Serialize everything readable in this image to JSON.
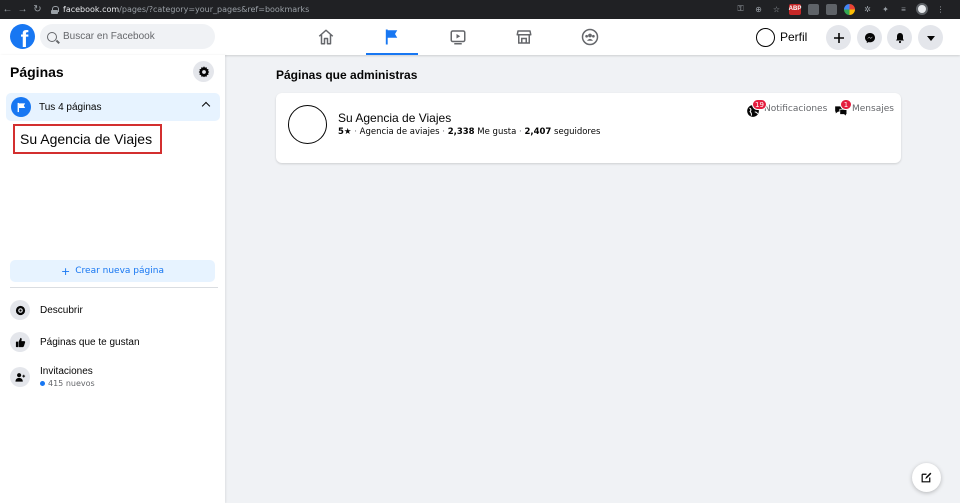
{
  "browser": {
    "url_domain": "facebook.com",
    "url_path": "/pages/?category=your_pages&ref=bookmarks"
  },
  "topbar": {
    "search_placeholder": "Buscar en Facebook",
    "profile_name": "Perfil"
  },
  "sidebar": {
    "title": "Páginas",
    "your_pages_label": "Tus 4 páginas",
    "page_link": "Su Agencia de Viajes",
    "create_page_label": "Crear nueva página",
    "items": [
      {
        "label": "Descubrir",
        "icon": "compass-icon"
      },
      {
        "label": "Páginas que te gustan",
        "icon": "thumbs-up-icon"
      },
      {
        "label": "Invitaciones",
        "icon": "person-add-icon",
        "sub": "415 nuevos"
      }
    ]
  },
  "main": {
    "section_title": "Páginas que administras",
    "page_card": {
      "name": "Su Agencia de Viajes",
      "rating": "5★",
      "category": "Agencia de aviajes",
      "likes_count": "2,338",
      "likes_label": "Me gusta",
      "followers_count": "2,407",
      "followers_label": "seguidores",
      "notifications_label": "Notificaciones",
      "notifications_count": "19",
      "messages_label": "Mensajes",
      "messages_count": "1"
    }
  },
  "colors": {
    "brand": "#1877f2",
    "badge": "#e41e3f",
    "highlight_border": "#d32f2f"
  }
}
